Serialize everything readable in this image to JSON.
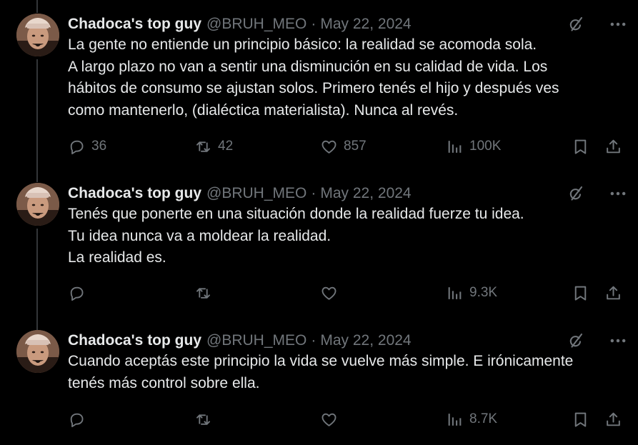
{
  "colors": {
    "background": "#000000",
    "text": "#e7e9ea",
    "muted": "#71767b",
    "thread_line": "#333639"
  },
  "tweets": [
    {
      "author": {
        "name": "Chadoca's top guy",
        "handle": "@BRUH_MEO"
      },
      "separator": "·",
      "date": "May 22, 2024",
      "lines": [
        "La gente no entiende un principio básico: la realidad se acomoda sola.",
        "A largo plazo no van a sentir una disminución en su calidad de vida. Los",
        "hábitos de consumo se ajustan solos. Primero tenés el hijo y después ves",
        "como mantenerlo, (dialéctica materialista). Nunca al revés."
      ],
      "stats": {
        "replies": "36",
        "reposts": "42",
        "likes": "857",
        "views": "100K"
      }
    },
    {
      "author": {
        "name": "Chadoca's top guy",
        "handle": "@BRUH_MEO"
      },
      "separator": "·",
      "date": "May 22, 2024",
      "lines": [
        "Tenés que ponerte en una situación donde la realidad fuerze tu idea.",
        "Tu idea nunca va a moldear la realidad.",
        "La realidad es."
      ],
      "stats": {
        "replies": "",
        "reposts": "",
        "likes": "",
        "views": "9.3K"
      }
    },
    {
      "author": {
        "name": "Chadoca's top guy",
        "handle": "@BRUH_MEO"
      },
      "separator": "·",
      "date": "May 22, 2024",
      "lines": [
        "Cuando aceptás este principio la vida se vuelve más simple. E irónicamente",
        "tenés más control sobre ella."
      ],
      "stats": {
        "replies": "",
        "reposts": "",
        "likes": "",
        "views": "8.7K"
      }
    }
  ],
  "icons": [
    "reply-icon",
    "repost-icon",
    "like-icon",
    "views-icon",
    "bookmark-icon",
    "share-icon",
    "grok-icon",
    "more-icon"
  ]
}
